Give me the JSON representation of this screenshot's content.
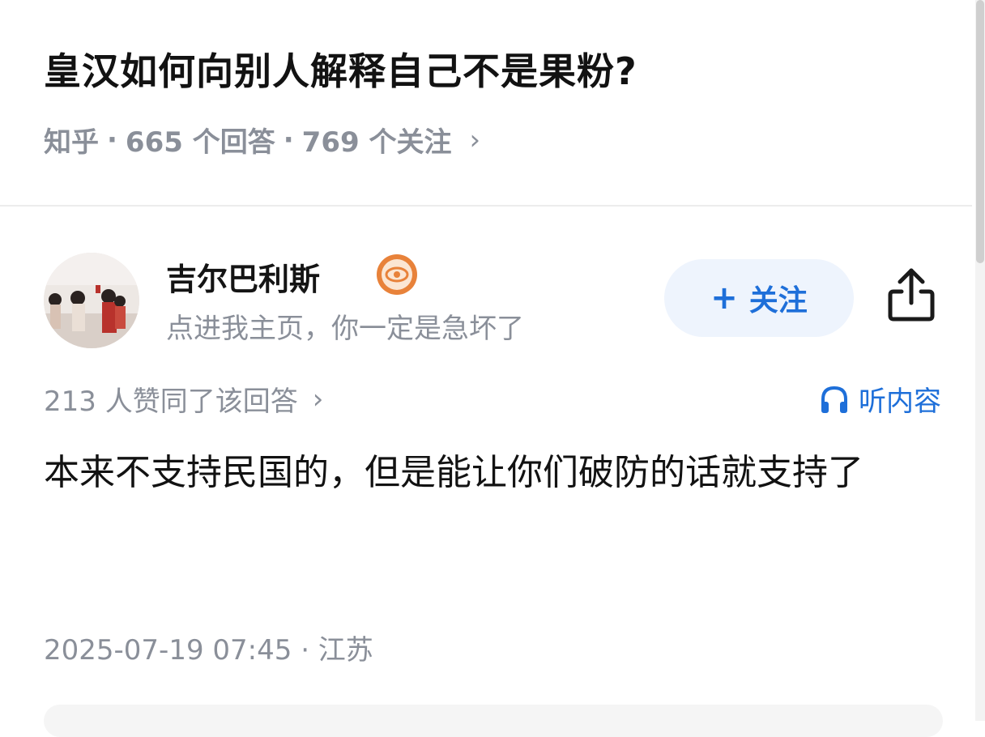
{
  "question": {
    "title": "皇汉如何向别人解释自己不是果粉?",
    "source": "知乎",
    "answers": "665 个回答",
    "followers": "769 个关注",
    "chevron": "›",
    "separator": "·"
  },
  "author": {
    "name": "吉尔巴利斯",
    "bio": "点进我主页，你一定是急坏了",
    "badge_icon": "eye-badge-icon"
  },
  "actions": {
    "follow_plus": "+",
    "follow_label": "关注",
    "share_icon": "share-icon"
  },
  "answer": {
    "likes": "213 人赞同了该回答",
    "chevron": "›",
    "listen_label": "听内容",
    "body": "本来不支持民国的，但是能让你们破防的话就支持了",
    "timestamp": "2025-07-19 07:45 · 江苏"
  },
  "colors": {
    "accent": "#1e6fd9",
    "muted": "#8a8f99",
    "badge": "#e8823a"
  }
}
